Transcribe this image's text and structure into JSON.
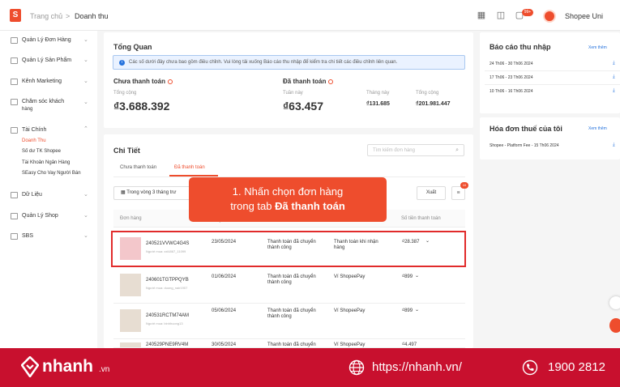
{
  "topbar": {
    "logo_glyph": "S",
    "breadcrumb_home": "Trang chủ",
    "breadcrumb_sep": ">",
    "breadcrumb_current": "Doanh thu",
    "notif_count": "99+",
    "user_name": "Shopee Uni"
  },
  "sidebar": {
    "items": [
      {
        "label": "Quản Lý Đơn Hàng"
      },
      {
        "label": "Quản Lý Sản Phẩm"
      },
      {
        "label": "Kênh Marketing"
      },
      {
        "label": "Chăm sóc khách"
      },
      {
        "label": "Tài Chính"
      },
      {
        "label": "Dữ Liệu"
      },
      {
        "label": "Quản Lý Shop"
      },
      {
        "label": "SBS"
      }
    ],
    "cham_soc_line2": "hàng",
    "sub_items": [
      {
        "label": "Doanh Thu"
      },
      {
        "label": "Số dư TK Shopee"
      },
      {
        "label": "Tài Khoản Ngân Hàng"
      },
      {
        "label": "SEasy Cho Vay Người Bán"
      }
    ]
  },
  "overview": {
    "title": "Tổng Quan",
    "notice_icon": "i",
    "notice": "Các số dưới đây chưa bao gồm điều chỉnh. Vui lòng tải xuống Báo cáo thu nhập để kiểm tra chi tiết các điều chỉnh liên quan.",
    "unpaid_title": "Chưa thanh toán",
    "unpaid_total_label": "Tổng cộng",
    "unpaid_total": "₫3.688.392",
    "paid_title": "Đã thanh toán",
    "week_label": "Tuần này",
    "week_value": "₫63.457",
    "month_label": "Tháng này",
    "month_value": "₫131.685",
    "paid_total_label": "Tổng cộng",
    "paid_total": "₫201.981.447"
  },
  "detail": {
    "title": "Chi Tiết",
    "search_placeholder": "Tìm kiếm đơn hàng",
    "tab_unpaid": "Chưa thanh toán",
    "tab_paid": "Đã thanh toán",
    "date_filter": "Trong vòng 3 tháng trư",
    "export": "Xuất",
    "list_badge": "10",
    "col_order": "Đơn hàng",
    "col_transfer": "chuyển tiền",
    "col_amount": "Số tiền thanh toán",
    "rows": [
      {
        "id": "240521VVWC4G4S",
        "buyer": "Người mua: xxl4867_11099",
        "date": "23/05/2024",
        "status1": "Thanh toán đã chuyển",
        "status2": "thành công",
        "method1": "Thanh toán khi nhận",
        "method2": "hàng",
        "amount": "₫28.387"
      },
      {
        "id": "240601TGTPPQYB",
        "buyer": "Người mua: duong_nair1907",
        "date": "01/06/2024",
        "status1": "Thanh toán đã chuyển",
        "status2": "thành công",
        "method1": "Ví ShopeePay",
        "method2": "",
        "amount": "₫899"
      },
      {
        "id": "240531RCTM74AM",
        "buyer": "Người mua: binhhuong13",
        "date": "05/06/2024",
        "status1": "Thanh toán đã chuyển",
        "status2": "thành công",
        "method1": "Ví ShopeePay",
        "method2": "",
        "amount": "₫899"
      },
      {
        "id": "240529PNE9RV4M",
        "buyer": "",
        "date": "30/05/2024",
        "status1": "Thanh toán đã chuyển",
        "status2": "",
        "method1": "Ví ShopeePay",
        "method2": "",
        "amount": "₫4.497"
      }
    ]
  },
  "tooltip": {
    "line1": "1. Nhấn chọn đơn hàng",
    "line2_prefix": "trong tab",
    "line2_bold": "Đã thanh toán"
  },
  "reports": {
    "title": "Báo cáo thu nhập",
    "see_more": "Xem thêm",
    "items": [
      {
        "label": "24 Th06 - 30 Th06 2024"
      },
      {
        "label": "17 Th06 - 23 Th06 2024"
      },
      {
        "label": "10 Th06 - 16 Th06 2024"
      }
    ]
  },
  "invoices": {
    "title": "Hóa đơn thuế của tôi",
    "see_more": "Xem thêm",
    "item": "Shopee - Platform Fee - 15 Th06 2024"
  },
  "footer": {
    "brand": "nhanh",
    "brand_suffix": ".vn",
    "website": "https://nhanh.vn/",
    "phone": "1900 2812"
  },
  "colors": {
    "brand": "#ee4d2d",
    "footer": "#c8102e",
    "link": "#2673dd"
  }
}
